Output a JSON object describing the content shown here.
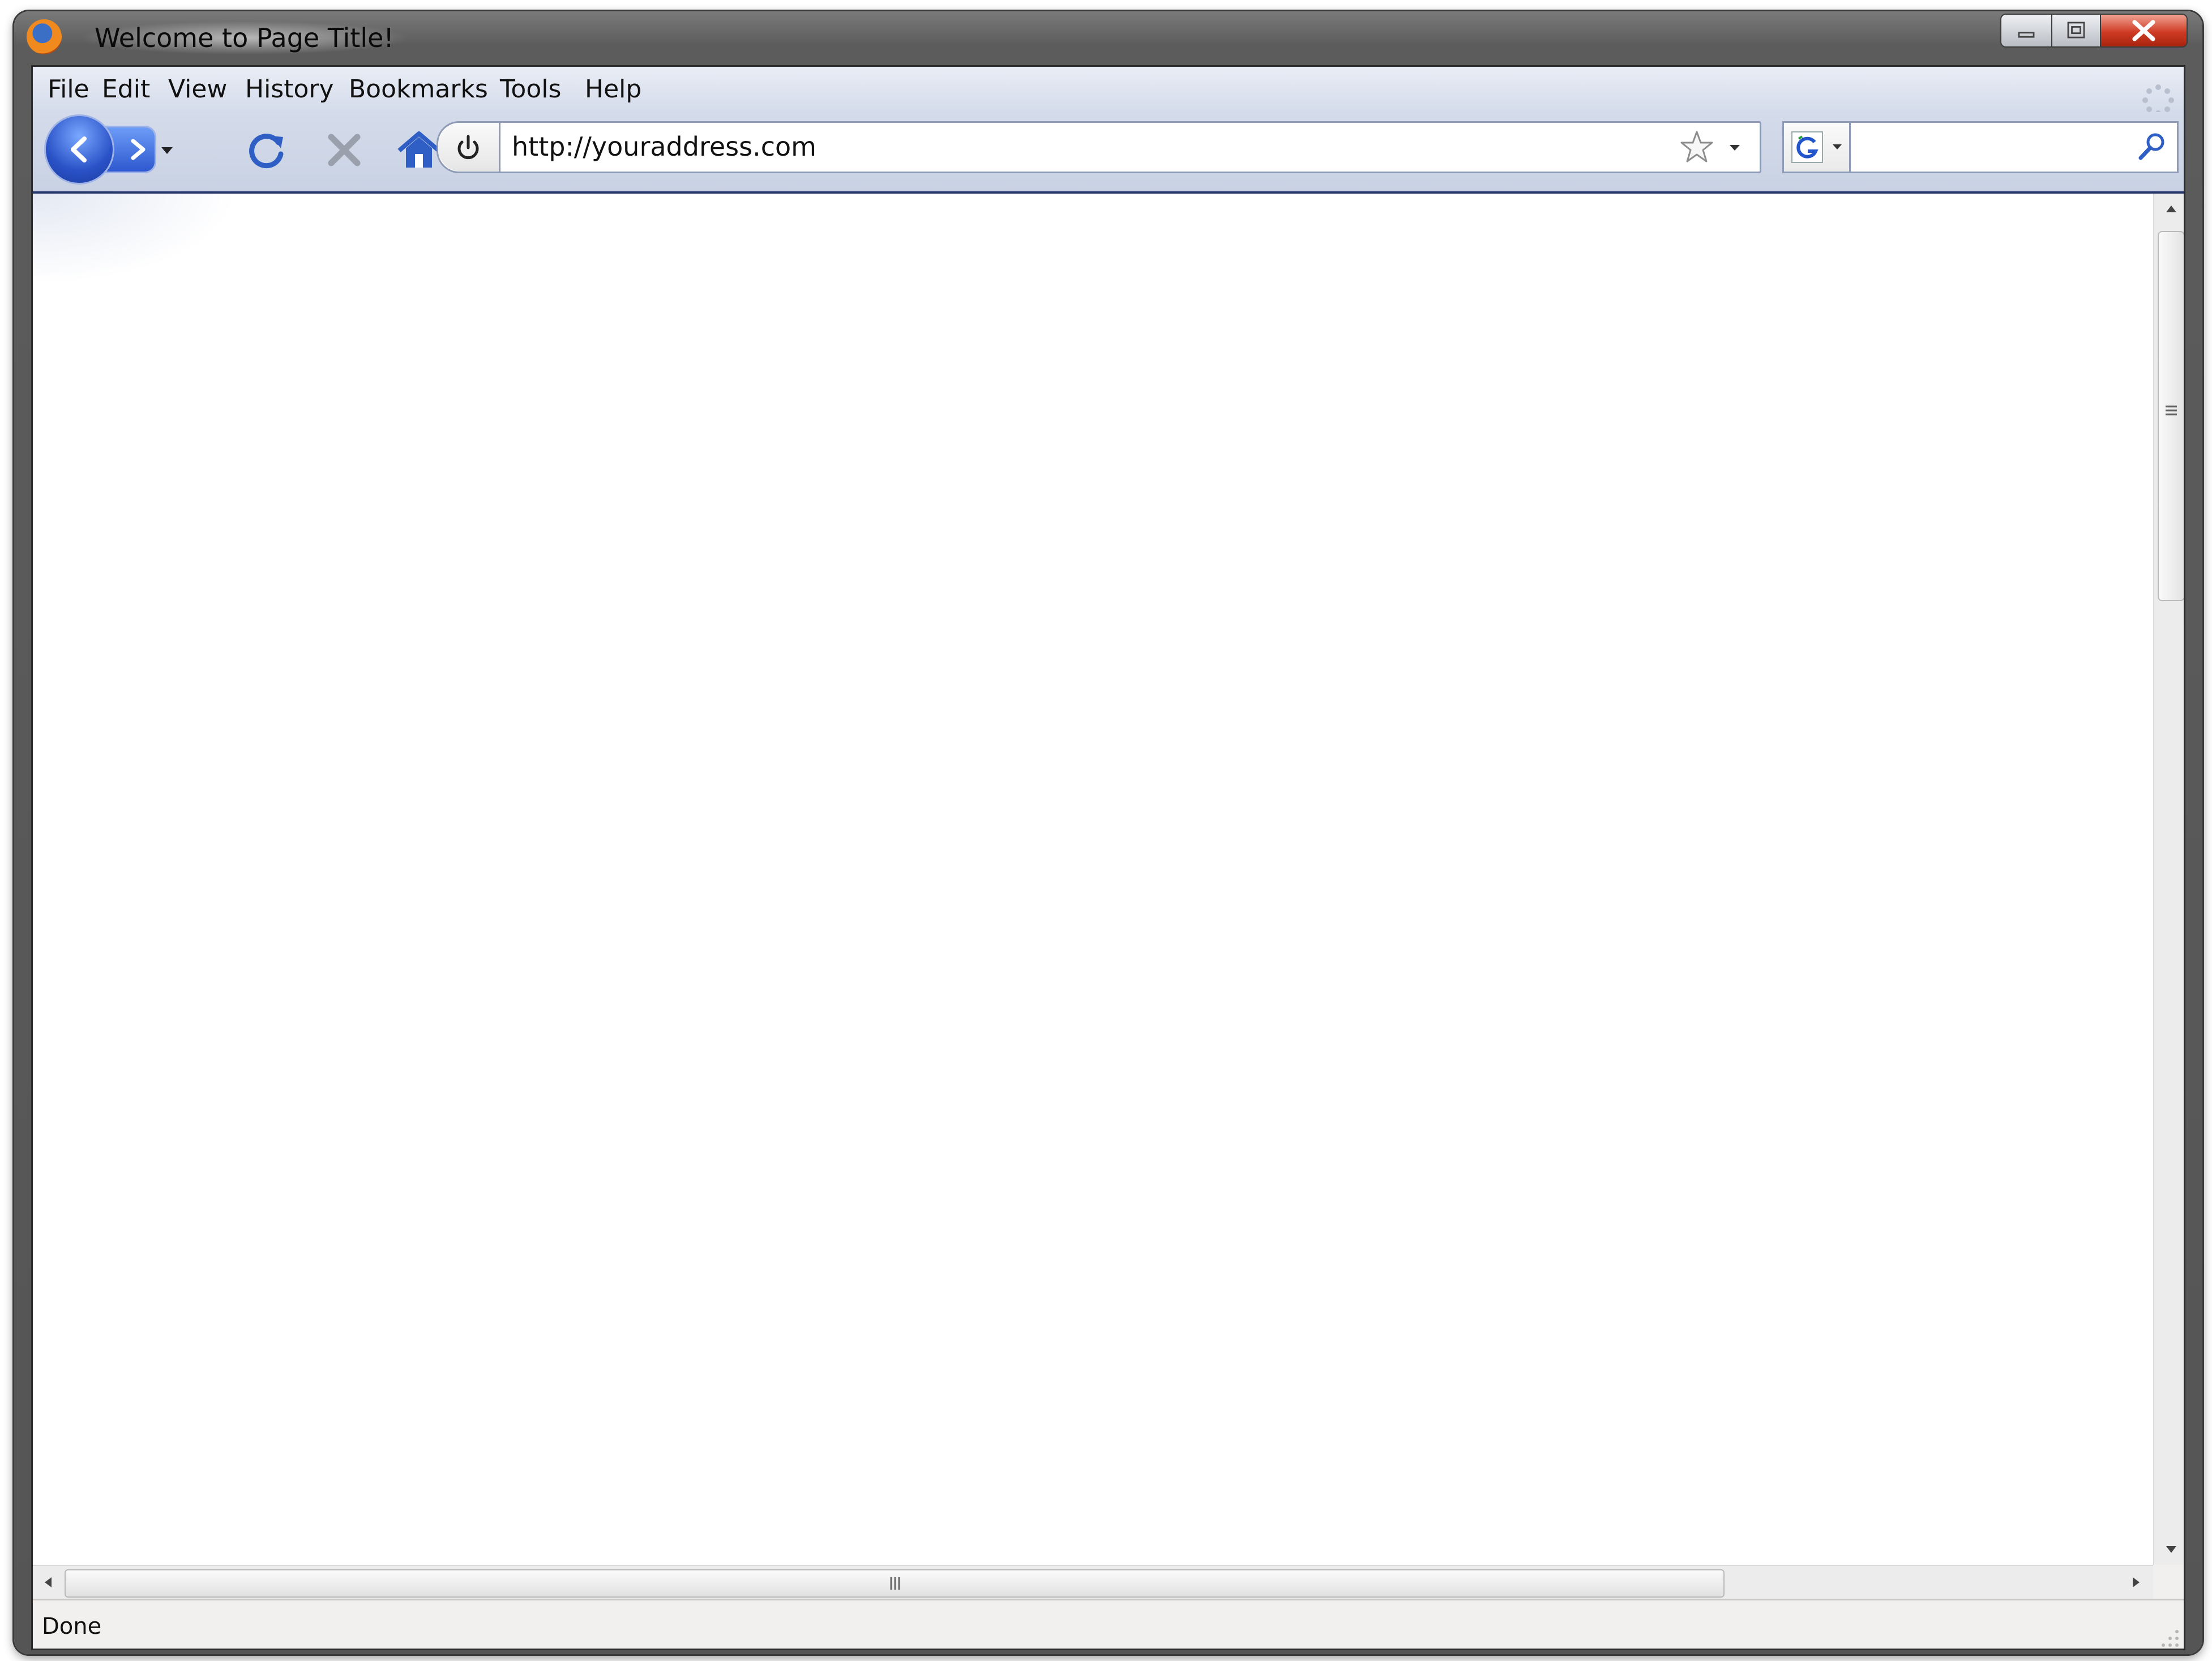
{
  "window": {
    "title": "Welcome to Page Title!",
    "app_icon": "firefox-icon"
  },
  "window_controls": [
    "minimize-icon",
    "maximize-icon",
    "close-icon"
  ],
  "menu": {
    "file": "File",
    "edit": "Edit",
    "view": "View",
    "history": "History",
    "bookmarks": "Bookmarks",
    "tools": "Tools",
    "help": "Help"
  },
  "toolbar": {
    "buttons": [
      "back-icon",
      "forward-icon",
      "history-dropdown-icon",
      "reload-icon",
      "stop-icon",
      "home-icon"
    ]
  },
  "urlbar": {
    "url": "http://youraddress.com",
    "icons": [
      "site-identity-icon",
      "bookmark-star-icon",
      "url-dropdown-icon"
    ]
  },
  "searchbar": {
    "value": "",
    "engine_icon": "google-icon",
    "go_icon": "magnifier-icon"
  },
  "status": {
    "text": "Done"
  },
  "colors": {
    "toolbar": "#d4dbea",
    "accent": "#2a52c7",
    "close_button": "#cf3b24"
  }
}
